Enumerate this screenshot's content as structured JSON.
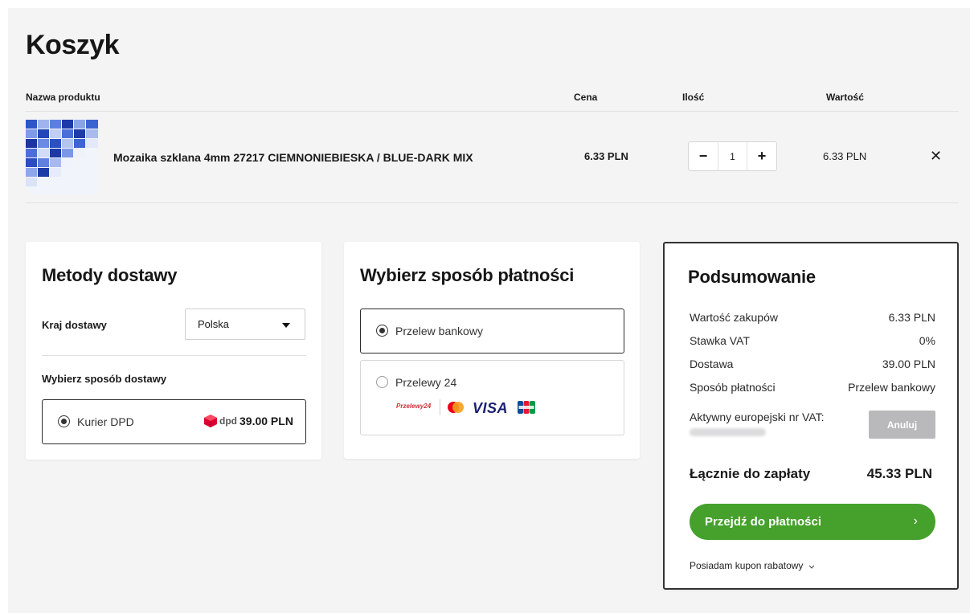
{
  "page": {
    "title": "Koszyk"
  },
  "table": {
    "headers": {
      "name": "Nazwa produktu",
      "price": "Cena",
      "qty": "Ilość",
      "total": "Wartość"
    }
  },
  "item": {
    "name": "Mozaika szklana 4mm 27217 CIEMNONIEBIESKA / BLUE-DARK MIX",
    "price": "6.33 PLN",
    "qty": "1",
    "total": "6.33 PLN",
    "minus": "−",
    "plus": "+",
    "remove": "✕"
  },
  "delivery": {
    "title": "Metody dostawy",
    "country_label": "Kraj dostawy",
    "country_value": "Polska",
    "method_label": "Wybierz sposób dostawy",
    "options": [
      {
        "label": "Kurier DPD",
        "brand": "dpd",
        "price": "39.00 PLN",
        "selected": true
      }
    ]
  },
  "payment": {
    "title": "Wybierz sposób płatności",
    "options": [
      {
        "label": "Przelew bankowy",
        "selected": true
      },
      {
        "label": "Przelewy 24",
        "selected": false
      }
    ],
    "logos": {
      "p24": "Przelewy24",
      "visa": "VISA"
    }
  },
  "summary": {
    "title": "Podsumowanie",
    "rows": [
      {
        "label": "Wartość zakupów",
        "value": "6.33 PLN"
      },
      {
        "label": "Stawka VAT",
        "value": "0%"
      },
      {
        "label": "Dostawa",
        "value": "39.00 PLN"
      },
      {
        "label": "Sposób płatności",
        "value": "Przelew bankowy"
      }
    ],
    "vat_label": "Aktywny europejski nr VAT:",
    "cancel": "Anuluj",
    "grand_label": "Łącznie do zapłaty",
    "grand_value": "45.33 PLN",
    "pay_button": "Przejdź do płatności",
    "pay_chevron": "›",
    "coupon": "Posiadam kupon rabatowy"
  },
  "colors": {
    "accent_green": "#45a02c",
    "dpd_red": "#dc0032",
    "visa_blue": "#1a1f71"
  }
}
